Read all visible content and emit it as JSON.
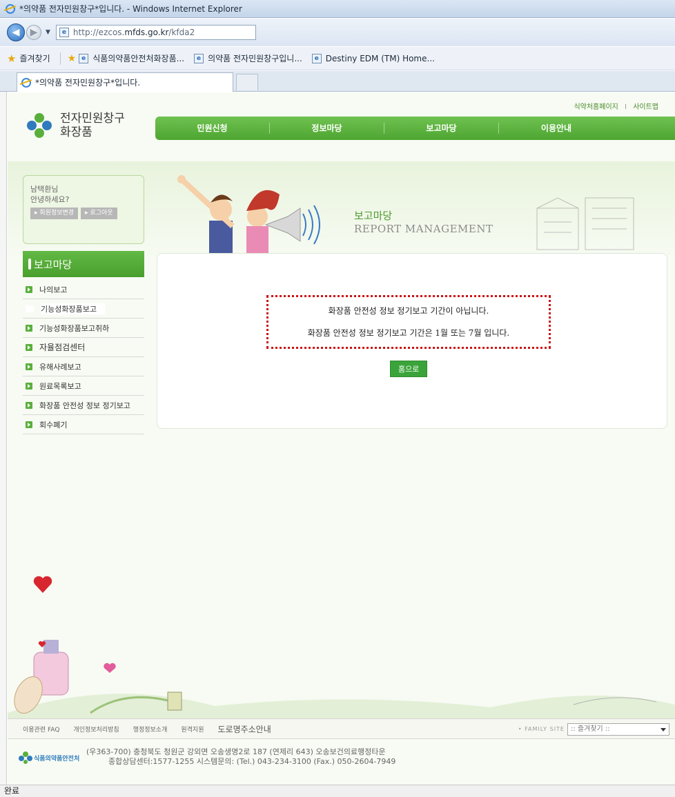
{
  "browser": {
    "window_title": "*의약품 전자민원창구*입니다. - Windows Internet Explorer",
    "url_prefix": "http://ezcos.",
    "url_domain": "mfds.go.kr",
    "url_path": "/kfda2",
    "favorites_label": "즐겨찾기",
    "favorites": [
      "식품의약품안전처화장품...",
      "의약품 전자민원창구입니...",
      "Destiny EDM (TM) Home..."
    ],
    "tab_title": "*의약품 전자민원창구*입니다.",
    "status": "완료"
  },
  "site": {
    "title_line1": "전자민원창구",
    "title_line2": "화장품",
    "util_links": [
      "식약처홈페이지",
      "사이트맵"
    ],
    "util_separator": "I",
    "gnb": [
      "민원신청",
      "정보마당",
      "보고마당",
      "이용안내"
    ]
  },
  "login": {
    "user": "남택환님",
    "greeting": "안녕하세요?",
    "buttons": [
      "▸ 회원정보변경",
      "▸ 로그아웃"
    ]
  },
  "banner": {
    "title": "보고마당",
    "subtitle": "REPORT MANAGEMENT"
  },
  "lnb": {
    "heading": "보고마당",
    "items": [
      "나의보고",
      "기능성화장품보고",
      "기능성화장품보고취하",
      "자율점검센터",
      "유해사례보고",
      "원료목록보고",
      "화장품 안전성 정보 정기보고",
      "회수폐기"
    ]
  },
  "notice": {
    "line1": "화장품 안전성 정보 정기보고 기간이 아닙니다.",
    "line2": "화장품 안전성 정보 정기보고 기간은 1월 또는 7월 입니다.",
    "home_button": "홈으로"
  },
  "footer": {
    "links": [
      "이용관련 FAQ",
      "개인정보처리방침",
      "행정정보소개",
      "원격지원",
      "도로명주소안내"
    ],
    "family_label": "• FAMILY SITE",
    "family_select": ":: 즐겨찾기 ::",
    "org_name": "식품의약품안전처",
    "address": "(우363-700) 충청북도 청원군 강외면 오송생명2로 187 (연제리 643) 오송보건의료행정타운",
    "contact": "종합상담센터:1577-1255  시스템문의: (Tel.) 043-234-3100  (Fax.) 050-2604-7949"
  },
  "colors": {
    "brand_green": "#4ea531",
    "notice_border": "#cc1111"
  }
}
